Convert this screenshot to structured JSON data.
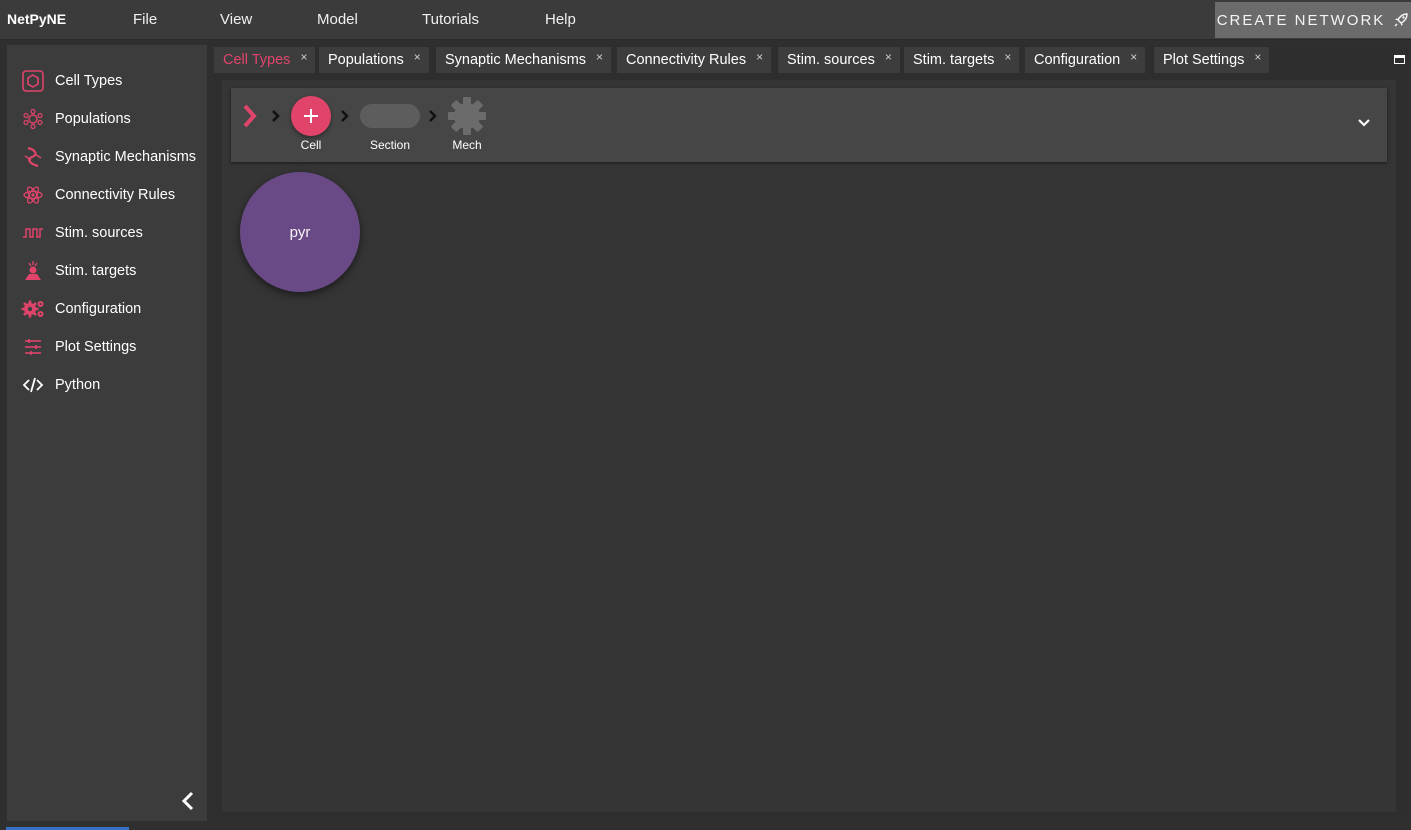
{
  "app": {
    "title": "NetPyNE"
  },
  "menu": {
    "items": [
      {
        "label": "File"
      },
      {
        "label": "View"
      },
      {
        "label": "Model"
      },
      {
        "label": "Tutorials"
      },
      {
        "label": "Help"
      }
    ],
    "create_network_label": "CREATE NETWORK"
  },
  "sidebar": {
    "items": [
      {
        "label": "Cell Types",
        "icon": "hexagon-icon"
      },
      {
        "label": "Populations",
        "icon": "cell-cluster-icon"
      },
      {
        "label": "Synaptic Mechanisms",
        "icon": "synapse-icon"
      },
      {
        "label": "Connectivity Rules",
        "icon": "atom-icon"
      },
      {
        "label": "Stim. sources",
        "icon": "pulse-wave-icon"
      },
      {
        "label": "Stim. targets",
        "icon": "target-neuron-icon"
      },
      {
        "label": "Configuration",
        "icon": "gears-icon"
      },
      {
        "label": "Plot Settings",
        "icon": "sliders-icon"
      },
      {
        "label": "Python",
        "icon": "code-icon"
      }
    ]
  },
  "tabs": [
    {
      "label": "Cell Types",
      "active": true
    },
    {
      "label": "Populations"
    },
    {
      "label": "Synaptic Mechanisms"
    },
    {
      "label": "Connectivity Rules"
    },
    {
      "label": "Stim. sources"
    },
    {
      "label": "Stim. targets"
    },
    {
      "label": "Configuration"
    },
    {
      "label": "Plot Settings"
    }
  ],
  "tab_close_glyph": "×",
  "breadcrumb": {
    "cell_label": "Cell",
    "section_label": "Section",
    "mech_label": "Mech"
  },
  "cells": [
    {
      "name": "pyr"
    }
  ],
  "colors": {
    "accent": "#e0446b",
    "cell_fill": "#6a4a86",
    "background": "#2f2f2f"
  }
}
